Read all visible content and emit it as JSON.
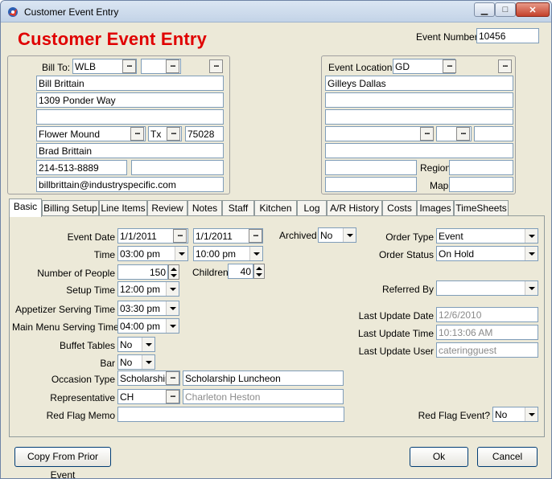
{
  "window": {
    "title": "Customer Event Entry"
  },
  "form": {
    "title": "Customer Event Entry",
    "event_number_label": "Event Number:",
    "event_number": "10456"
  },
  "bill_to": {
    "label": "Bill To:",
    "code": "WLB",
    "name": "Bill Brittain",
    "address1": "1309 Ponder Way",
    "address2": "",
    "city": "Flower Mound",
    "state": "Tx",
    "zip": "75028",
    "contact": "Brad Brittain",
    "phone": "214-513-8889",
    "phone2": "",
    "email": "billbrittain@industryspecific.com"
  },
  "event_location": {
    "label": "Event Location:",
    "code": "GD",
    "name": "Gilleys Dallas",
    "address1": "",
    "address2": "",
    "city": "",
    "state": "",
    "zip": "",
    "contact": "",
    "phone": "",
    "region_label": "Region",
    "region": "",
    "map_label": "Map",
    "map": ""
  },
  "tabs": [
    "Basic",
    "Billing Setup",
    "Line Items",
    "Review",
    "Notes",
    "Staff",
    "Kitchen",
    "Log",
    "A/R History",
    "Costs",
    "Images",
    "TimeSheets"
  ],
  "basic": {
    "event_date_label": "Event Date",
    "event_date_start": "1/1/2011",
    "event_date_end": "1/1/2011",
    "time_label": "Time",
    "time_start": "03:00 pm",
    "time_end": "10:00 pm",
    "people_label": "Number of People",
    "people": "150",
    "children_label": "Children",
    "children": "40",
    "setup_label": "Setup Time",
    "setup": "12:00 pm",
    "appetizer_label": "Appetizer Serving Time",
    "appetizer": "03:30 pm",
    "main_label": "Main Menu Serving Time",
    "main": "04:00 pm",
    "buffet_label": "Buffet Tables",
    "buffet": "No",
    "bar_label": "Bar",
    "bar": "No",
    "occasion_label": "Occasion Type",
    "occasion_code": "Scholarship",
    "occasion_desc": "Scholarship Luncheon",
    "rep_label": "Representative",
    "rep_code": "CH",
    "rep_name": "Charleton Heston",
    "memo_label": "Red Flag Memo",
    "memo": "",
    "archived_label": "Archived",
    "archived": "No",
    "order_type_label": "Order Type",
    "order_type": "Event",
    "order_status_label": "Order Status",
    "order_status": "On Hold",
    "referred_label": "Referred By",
    "referred": "",
    "last_date_label": "Last Update Date",
    "last_date": "12/6/2010",
    "last_time_label": "Last Update Time",
    "last_time": "10:13:06 AM",
    "last_user_label": "Last Update User",
    "last_user": "cateringguest",
    "red_flag_label": "Red Flag Event?",
    "red_flag": "No"
  },
  "buttons": {
    "copy": "Copy From Prior Event",
    "ok": "Ok",
    "cancel": "Cancel"
  }
}
